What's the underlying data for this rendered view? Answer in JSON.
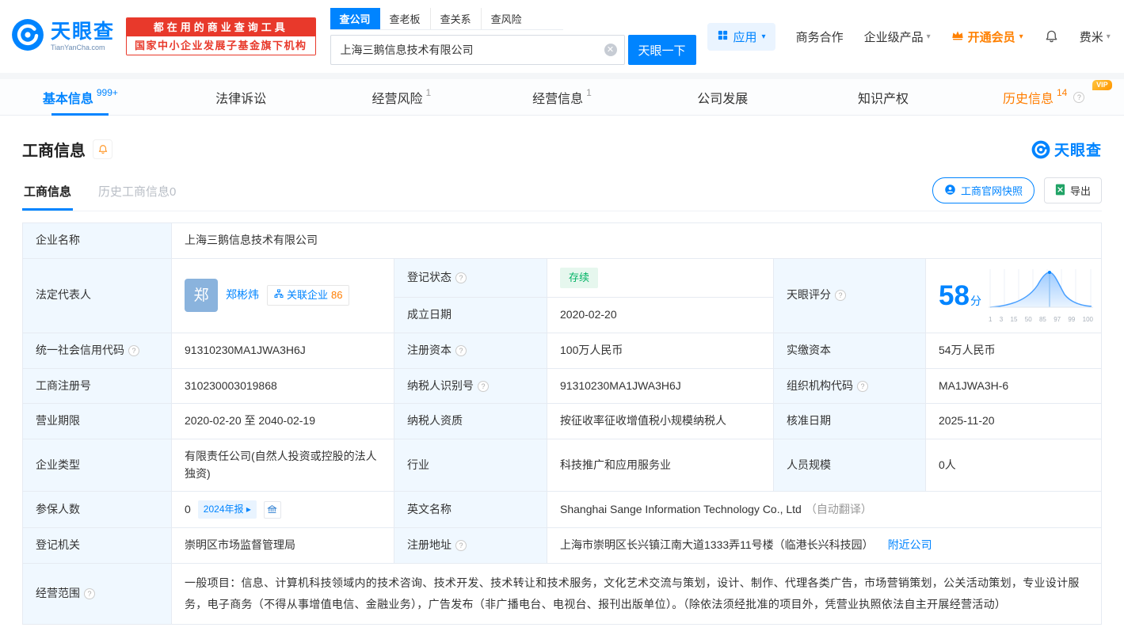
{
  "colors": {
    "primary": "#0084ff",
    "orange": "#ff7d00",
    "red": "#e8392b",
    "green": "#00b365",
    "label_bg": "#f0f8ff"
  },
  "header": {
    "logo_cn": "天眼查",
    "logo_en": "TianYanCha.com",
    "banner_line1": "都在用的商业查询工具",
    "banner_line2": "国家中小企业发展子基金旗下机构",
    "search_tabs": [
      {
        "label": "查公司",
        "active": true
      },
      {
        "label": "查老板",
        "active": false
      },
      {
        "label": "查关系",
        "active": false
      },
      {
        "label": "查风险",
        "active": false
      }
    ],
    "search_value": "上海三鹅信息技术有限公司",
    "search_button": "天眼一下",
    "app_label": "应用",
    "biz_label": "商务合作",
    "product_label": "企业级产品",
    "vip_label": "开通会员",
    "user_label": "费米"
  },
  "tabs": [
    {
      "label": "基本信息",
      "badge": "999+"
    },
    {
      "label": "法律诉讼",
      "badge": ""
    },
    {
      "label": "经营风险",
      "badge": "1"
    },
    {
      "label": "经营信息",
      "badge": "1"
    },
    {
      "label": "公司发展",
      "badge": ""
    },
    {
      "label": "知识产权",
      "badge": ""
    },
    {
      "label": "历史信息",
      "badge": "14",
      "vip_tag": "VIP"
    }
  ],
  "section": {
    "title": "工商信息",
    "logo": "天眼查",
    "subtab_active": "工商信息",
    "subtab_inactive": "历史工商信息0",
    "snapshot_button": "工商官网快照",
    "export_button": "导出"
  },
  "info": {
    "company_name_label": "企业名称",
    "company_name": "上海三鹅信息技术有限公司",
    "legal_rep_label": "法定代表人",
    "legal_rep_avatar": "郑",
    "legal_rep_name": "郑彬炜",
    "related_label": "关联企业",
    "related_count": "86",
    "reg_status_label": "登记状态",
    "reg_status": "存续",
    "establish_label": "成立日期",
    "establish_date": "2020-02-20",
    "score_label": "天眼评分",
    "score": "58",
    "score_unit": "分",
    "score_axis": [
      "1",
      "3",
      "15",
      "50",
      "85",
      "97",
      "99",
      "100"
    ],
    "credit_code_label": "统一社会信用代码",
    "credit_code": "91310230MA1JWA3H6J",
    "reg_capital_label": "注册资本",
    "reg_capital": "100万人民币",
    "paid_capital_label": "实缴资本",
    "paid_capital": "54万人民币",
    "reg_number_label": "工商注册号",
    "reg_number": "310230003019868",
    "taxpayer_id_label": "纳税人识别号",
    "taxpayer_id": "91310230MA1JWA3H6J",
    "org_code_label": "组织机构代码",
    "org_code": "MA1JWA3H-6",
    "business_term_label": "营业期限",
    "business_term": "2020-02-20 至 2040-02-19",
    "taxpayer_quality_label": "纳税人资质",
    "taxpayer_quality": "按征收率征收增值税小规模纳税人",
    "approval_date_label": "核准日期",
    "approval_date": "2025-11-20",
    "company_type_label": "企业类型",
    "company_type": "有限责任公司(自然人投资或控股的法人独资)",
    "industry_label": "行业",
    "industry": "科技推广和应用服务业",
    "staff_size_label": "人员规模",
    "staff_size": "0人",
    "insured_label": "参保人数",
    "insured_count": "0",
    "annual_report_badge": "2024年报",
    "english_name_label": "英文名称",
    "english_name": "Shanghai Sange Information Technology Co., Ltd",
    "english_name_note": "（自动翻译）",
    "reg_authority_label": "登记机关",
    "reg_authority": "崇明区市场监督管理局",
    "reg_address_label": "注册地址",
    "reg_address": "上海市崇明区长兴镇江南大道1333弄11号楼（临港长兴科技园）",
    "nearby_link": "附近公司",
    "business_scope_label": "经营范围",
    "business_scope": "一般项目：信息、计算机科技领域内的技术咨询、技术开发、技术转让和技术服务，文化艺术交流与策划，设计、制作、代理各类广告，市场营销策划，公关活动策划，专业设计服务，电子商务（不得从事增值电信、金融业务），广告发布（非广播电台、电视台、报刊出版单位）。（除依法须经批准的项目外，凭营业执照依法自主开展经营活动）"
  }
}
